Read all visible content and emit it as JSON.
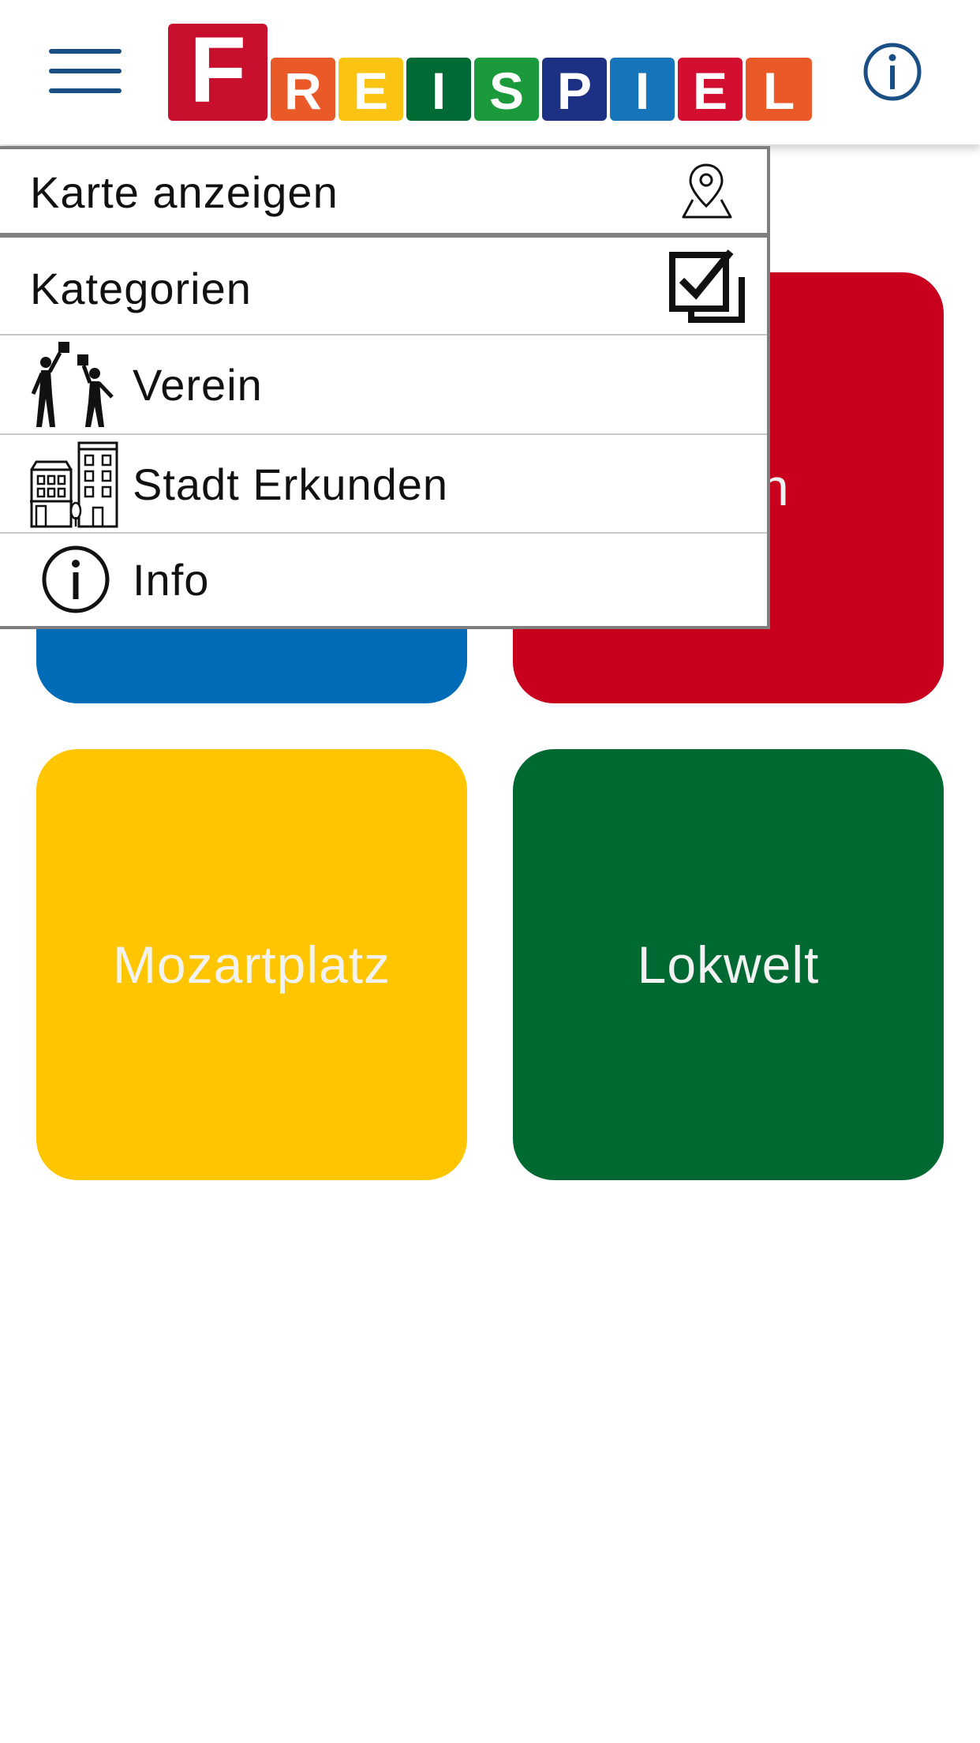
{
  "header": {
    "menu_icon": "hamburger-menu-icon",
    "info_icon": "info-circle-icon",
    "logo": {
      "text": "FREISPIEL",
      "letters": [
        {
          "char": "F",
          "color": "#c8102e"
        },
        {
          "char": "R",
          "color": "#ea5a28"
        },
        {
          "char": "E",
          "color": "#fbc312"
        },
        {
          "char": "I",
          "color": "#006a35"
        },
        {
          "char": "S",
          "color": "#1a9a3a"
        },
        {
          "char": "P",
          "color": "#1d3184"
        },
        {
          "char": "I",
          "color": "#1675bb"
        },
        {
          "char": "E",
          "color": "#d20f30"
        },
        {
          "char": "L",
          "color": "#ea5a28"
        }
      ]
    },
    "accent_color": "#1a4f86"
  },
  "menu": {
    "items": [
      {
        "label": "Karte anzeigen",
        "icon": "map-pin-icon"
      },
      {
        "label": "Kategorien",
        "icon": "checkbox-stack-icon"
      },
      {
        "label": "Verein",
        "icon": "people-playing-icon"
      },
      {
        "label": "Stadt Erkunden",
        "icon": "city-buildings-icon"
      },
      {
        "label": "Info",
        "icon": "info-circle-icon"
      }
    ]
  },
  "tiles": [
    {
      "label": "",
      "color": "#006cb7"
    },
    {
      "label": "on",
      "color": "#c8001e"
    },
    {
      "label": "Mozartplatz",
      "color": "#ffc600"
    },
    {
      "label": "Lokwelt",
      "color": "#006932"
    }
  ]
}
